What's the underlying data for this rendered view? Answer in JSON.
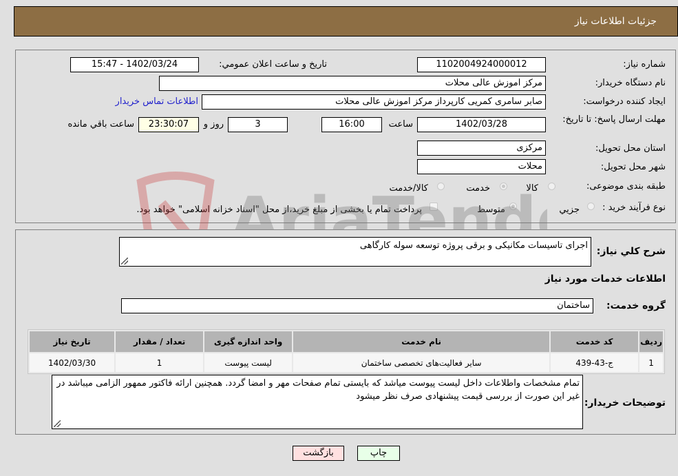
{
  "header": {
    "title": "جزئیات اطلاعات نیاز"
  },
  "form": {
    "need_number": {
      "label": "شماره نیاز:",
      "value": "1102004924000012"
    },
    "announce": {
      "label": "تاریخ و ساعت اعلان عمومي:",
      "value": "1402/03/24 - 15:47"
    },
    "buyer_org": {
      "label": "نام دستگاه خریدار:",
      "value": "مرکز اموزش عالی محلات"
    },
    "creator": {
      "label": "ایجاد کننده درخواست:",
      "value": "صابر  سامری کمریی کارپرداز مرکز اموزش عالی محلات"
    },
    "buyer_contact_link": "اطلاعات تماس خریدار",
    "deadline": {
      "label": "مهلت ارسال پاسخ: تا تاریخ:",
      "date": "1402/03/28",
      "time_label": "ساعت",
      "time": "16:00",
      "days": "3",
      "days_label": "روز و",
      "remaining": "23:30:07",
      "remaining_label": "ساعت باقي مانده"
    },
    "province": {
      "label": "استان محل تحویل:",
      "value": "مرکزی"
    },
    "city": {
      "label": "شهر محل تحویل:",
      "value": "محلات"
    },
    "category": {
      "label": "طبقه بندی موضوعی:",
      "options": [
        "کالا",
        "خدمت",
        "کالا/خدمت"
      ],
      "selected": "خدمت"
    },
    "purchase_type": {
      "label": "نوع فرآیند خرید :",
      "options": [
        "جزيي",
        "متوسط"
      ],
      "selected": "متوسط",
      "treasury_note": "پرداخت تمام یا بخشی از مبلغ خرید،از محل \"اسناد خزانه اسلامی\" خواهد بود.",
      "treasury_checked": false
    }
  },
  "description": {
    "label": "شرح کلي نياز:",
    "value": "اجرای تاسیسات مکانیکی و برقی پروژه توسعه سوله کارگاهی"
  },
  "services_section": {
    "title": "اطلاعات خدمات مورد نیاز",
    "group_label": "گروه خدمت:",
    "group_value": "ساختمان",
    "table": {
      "headers": [
        "ردیف",
        "کد خدمت",
        "نام خدمت",
        "واحد اندازه گیری",
        "تعداد / مقدار",
        "تاریخ نیاز"
      ],
      "rows": [
        [
          "1",
          "ج-43-439",
          "سایر فعالیت‌های تخصصی ساختمان",
          "لیست پیوست",
          "1",
          "1402/03/30"
        ]
      ]
    }
  },
  "buyer_notes": {
    "label": "توضیحات خریدار:",
    "value": "تمام مشخصات واطلاعات داخل لیست پیوست میاشد که بایستی تمام صفحات مهر و امضا گردد. همچنین ارائه فاکتور ممهور الزامی میباشد در غیر این صورت از بررسی قیمت پیشنهادی صرف نظر میشود"
  },
  "buttons": {
    "print": "چاپ",
    "back": "بازگشت"
  },
  "watermark": {
    "text": "AriaTender.neT"
  }
}
